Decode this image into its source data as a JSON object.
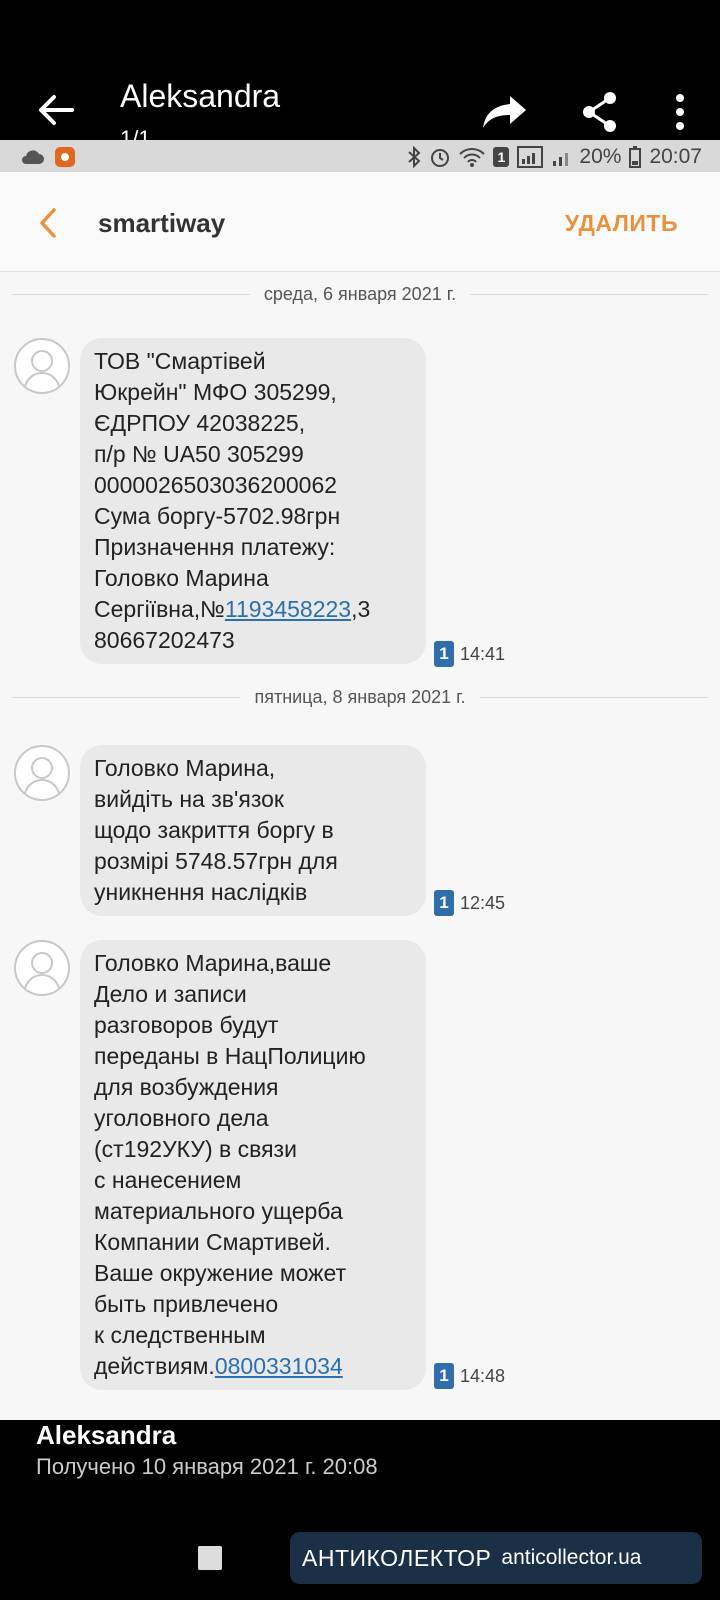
{
  "viewer": {
    "title": "Aleksandra",
    "counter": "1/1",
    "icons": [
      "back-arrow-icon",
      "forward-icon",
      "share-icon",
      "more-vert-icon"
    ]
  },
  "status_bar": {
    "battery": "20%",
    "time": "20:07",
    "sim_badge": "1"
  },
  "header": {
    "title": "smartiway",
    "delete_label": "УДАЛИТЬ",
    "accent_color": "#e8913f"
  },
  "conversation": {
    "date_1": "среда, 6 января 2021 г.",
    "date_2": "пятница, 8 января 2021 г.",
    "messages": [
      {
        "text": "ТОВ \"Смартівей\nЮкрейн\" МФО 305299,\nЄДРПОУ 42038225,\nп/р № UA50 305299\n0000026503036200062\nСума боргу-5702.98грн\nПризначення платежу:\nГоловко Марина\nСергіївна,№",
        "link": "1193458223",
        "text_after": ",3\n80667202473",
        "sim": "1",
        "time": "14:41"
      },
      {
        "text": "Головко Марина,\nвийдіть на зв'язок\nщодо закриття боргу в\nрозмірі 5748.57грн для\nуникнення наслідків",
        "sim": "1",
        "time": "12:45"
      },
      {
        "text": "Головко Марина,ваше\nДело и записи\nразговоров будут\nпереданы в НацПолицию\nдля возбуждения\nуголовного дела\n(ст192УКУ) в связи\nс нанесением\nматериального ущерба\nКомпании Смартивей.\nВаше окружение может\nбыть привлечено\nк следственным\nдействиям.",
        "link": "0800331034",
        "sim": "1",
        "time": "14:48"
      }
    ]
  },
  "bottom": {
    "sender": "Aleksandra",
    "received": "Получено 10 января 2021 г. 20:08"
  },
  "watermark": {
    "brand": "АНТИКОЛЕКТОР",
    "url": "anticollector.ua"
  }
}
